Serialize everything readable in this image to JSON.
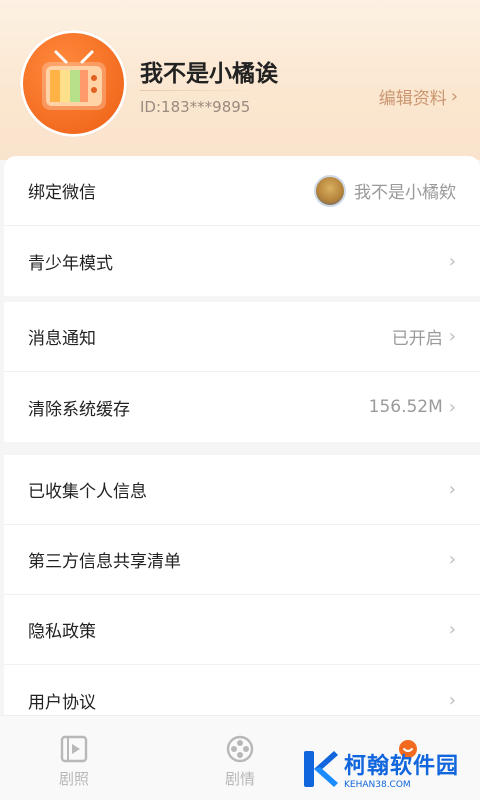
{
  "profile": {
    "nickname": "我不是小橘诶",
    "id_text": "ID:183***9895",
    "edit_label": "编辑资料",
    "chevron": "›"
  },
  "settings_group1": [
    {
      "label": "绑定微信",
      "value": "我不是小橘欸",
      "has_avatar": true
    },
    {
      "label": "青少年模式",
      "value": ""
    }
  ],
  "settings_group2": [
    {
      "label": "消息通知",
      "value": "已开启"
    },
    {
      "label": "清除系统缓存",
      "value": "156.52M"
    }
  ],
  "settings_group3": [
    {
      "label": "已收集个人信息",
      "value": ""
    },
    {
      "label": "第三方信息共享清单",
      "value": ""
    },
    {
      "label": "隐私政策",
      "value": ""
    },
    {
      "label": "用户协议",
      "value": ""
    }
  ],
  "tabbar": {
    "items": [
      {
        "label": "剧照",
        "icon": "film-icon"
      },
      {
        "label": "剧情",
        "icon": "reel-icon"
      },
      {
        "label": "",
        "icon": "smile-icon"
      }
    ]
  },
  "watermark": {
    "cn": "柯翰软件园",
    "en": "KEHAN38.COM"
  },
  "colors": {
    "accent_orange": "#f26a1f",
    "edit_text": "#c99670",
    "watermark_blue": "#1166dd"
  }
}
